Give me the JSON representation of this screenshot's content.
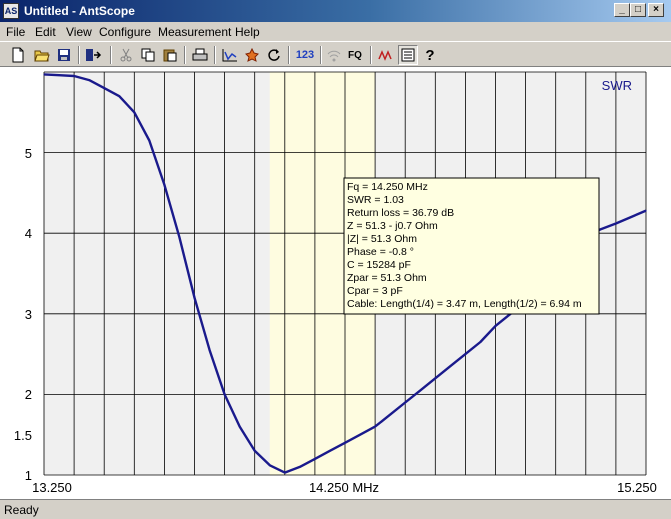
{
  "window": {
    "title": "Untitled - AntScope",
    "icon_label": "AS",
    "controls": [
      "minimize-icon",
      "maximize-icon",
      "close-icon"
    ]
  },
  "menu": [
    "File",
    "Edit",
    "View",
    "Configure",
    "Measurement",
    "Help"
  ],
  "toolbar": {
    "icons": [
      "new-icon",
      "open-icon",
      "save-icon",
      "export-icon",
      "cut-icon",
      "copy-icon",
      "paste-icon",
      "print-icon",
      "chart-icon",
      "star-icon",
      "refresh-icon",
      "digits-icon",
      "wireless-icon",
      "fq-icon",
      "graph-icon",
      "list-icon",
      "help-icon"
    ],
    "digits_label": "123",
    "fq_label": "FQ",
    "help_label": "?"
  },
  "chart_data": {
    "type": "line",
    "series": [
      {
        "name": "SWR",
        "color": "#1a1a8c",
        "x": [
          13.25,
          13.3,
          13.35,
          13.4,
          13.45,
          13.5,
          13.55,
          13.6,
          13.65,
          13.7,
          13.75,
          13.8,
          13.85,
          13.9,
          13.95,
          14.0,
          14.05,
          14.1,
          14.15,
          14.2,
          14.25,
          14.3,
          14.35,
          14.4,
          14.45,
          14.5,
          14.55,
          14.6,
          14.65,
          14.7,
          14.75,
          14.8,
          14.85,
          14.9,
          14.95,
          15.0,
          15.05,
          15.1,
          15.15,
          15.2,
          15.25
        ],
        "y": [
          5.97,
          5.96,
          5.95,
          5.9,
          5.8,
          5.7,
          5.5,
          5.15,
          4.6,
          3.95,
          3.2,
          2.55,
          2.0,
          1.6,
          1.3,
          1.12,
          1.03,
          1.1,
          1.2,
          1.3,
          1.4,
          1.5,
          1.6,
          1.75,
          1.9,
          2.05,
          2.2,
          2.35,
          2.5,
          2.65,
          2.85,
          3.0,
          3.15,
          3.35,
          3.55,
          3.8,
          3.95,
          4.05,
          4.12,
          4.2,
          4.28
        ]
      }
    ],
    "x_ticks": [
      "13.250",
      "14.250 MHz",
      "15.250"
    ],
    "y_ticks": [
      "1",
      "1.5",
      "2",
      "3",
      "4",
      "5"
    ],
    "xlim": [
      13.25,
      15.25
    ],
    "ylim": [
      1.0,
      6.0
    ],
    "highlight_band": [
      14.0,
      14.35
    ],
    "marker_x": 14.25,
    "grid": true,
    "legend": "SWR",
    "legend_position": "top-right"
  },
  "tooltip": {
    "lines": [
      "Fq = 14.250 MHz",
      "SWR = 1.03",
      "Return loss = 36.79 dB",
      "Z = 51.3 - j0.7 Ohm",
      "|Z| = 51.3 Ohm",
      "Phase = -0.8 °",
      "C = 15284 pF",
      "Zpar = 51.3 Ohm",
      "Cpar = 3 pF",
      "Cable: Length(1/4) = 3.47 m, Length(1/2) = 6.94 m"
    ]
  },
  "status": {
    "text": "Ready"
  }
}
